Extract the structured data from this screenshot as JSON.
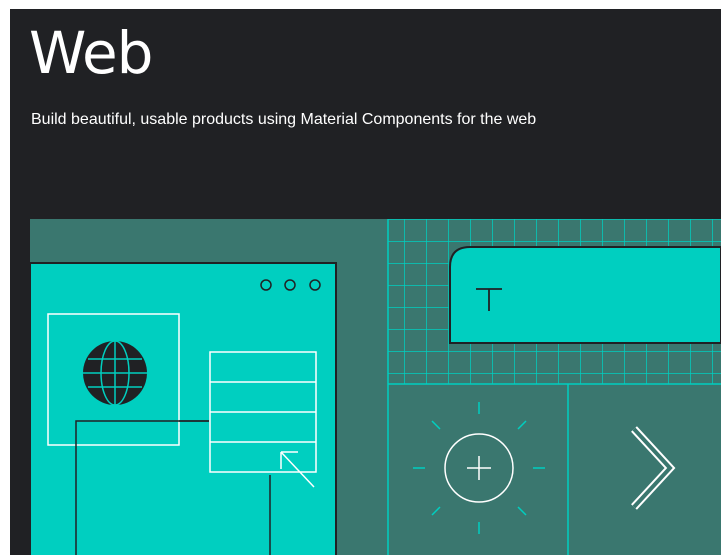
{
  "page": {
    "title": "Web",
    "subtitle": "Build beautiful, usable products using Material Components for the web"
  },
  "hero": {
    "icons": [
      "globe-icon",
      "three-dots-icon",
      "text-tool-icon",
      "cursor-arrow-icon",
      "add-icon",
      "chevron-right-icon"
    ]
  },
  "colors": {
    "page_background": "#202124",
    "teal_dark": "#3a776f",
    "teal_bright": "#00cfc0",
    "line": "#ffffff",
    "outline": "#202124"
  }
}
